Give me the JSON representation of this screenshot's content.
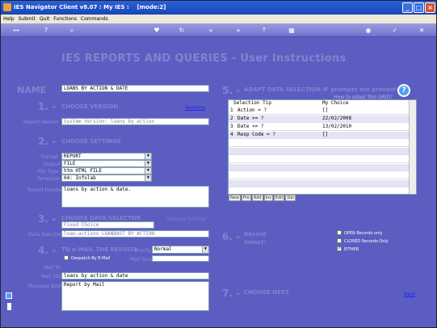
{
  "window": {
    "title": "IES Navigator Client v8.07 : My IES :",
    "mode": "[mode:2]"
  },
  "menubar": [
    "Help",
    "Submit",
    "Quit",
    "Functions",
    "Commands"
  ],
  "heading": "IES REPORTS AND QUERIES - User Instructions",
  "name": {
    "label": "NAME",
    "value": "LOANS BY ACTION & DATE"
  },
  "step1": {
    "num": "1. -",
    "title": "CHOOSE VERSION",
    "link": "Versions",
    "field_label": "Report Version",
    "value": "System Version: loans by action"
  },
  "step2": {
    "num": "2. -",
    "title": "CHOOSE SETTINGS",
    "rows": [
      {
        "label": "Format",
        "value": "REPORT"
      },
      {
        "label": "Output",
        "value": "FILE"
      },
      {
        "label": "File Type",
        "value": "htm HTML FILE"
      },
      {
        "label": "Template",
        "value": "04: Infolab"
      }
    ],
    "header_label": "Report Header",
    "header_value": "loans by action & date."
  },
  "step3": {
    "num": "3. -",
    "title": "CHOOSE DATA SELECTOR",
    "link": "Selector Setting",
    "fixed": "Fixed Choice",
    "selector_label": "Data Selector",
    "selector_value": "loan-actions LOANBAST BY ACTION"
  },
  "step4": {
    "num": "4. -",
    "title": "TO e-MAIL THE RESULTS",
    "priority_label": "Priority",
    "priority_value": "Normal",
    "despatch": "Despatch By E-Mail",
    "mail_server_label": "Mail Server",
    "mail_to_label": "Mail To",
    "mail_title_label": "Mail Title",
    "mail_title_value": "loans by action & date",
    "body_label": "Message Body",
    "body_value": "Report by Mail"
  },
  "step5": {
    "num": "5. -",
    "title": "ADAPT DATA SELECTION IF prompts are present",
    "hint": "How to adapt this GRID?",
    "col1": "Selection Tip",
    "col2": "My Choice",
    "rows": [
      {
        "n": "1",
        "tip": "Action = ?",
        "choice": "[]"
      },
      {
        "n": "2",
        "tip": "Date >= ?",
        "choice": "22/02/2008"
      },
      {
        "n": "3",
        "tip": "Date <= ?",
        "choice": "13/02/2010"
      },
      {
        "n": "4",
        "tip": "Resp Code = ?",
        "choice": "[]"
      }
    ],
    "nav": [
      "New",
      "Pre",
      "Add",
      "Ins",
      "Edit",
      "Del"
    ]
  },
  "step6": {
    "num": "6. -",
    "title": "Record",
    "title2": "Select:",
    "options": [
      "OPEN Records only",
      "CLOSED Records Only",
      "EITHER"
    ],
    "checked": 2
  },
  "step7": {
    "num": "7. -",
    "title": "CHOOSE NEXT",
    "link": "Next"
  },
  "colors": {
    "bg": "#5b5ec0",
    "label": "#8c8fd8",
    "heading": "#8083d0"
  }
}
